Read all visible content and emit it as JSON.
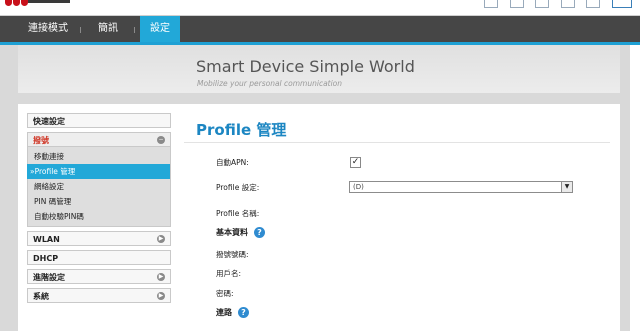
{
  "nav": {
    "tabs": [
      {
        "label": "連接模式"
      },
      {
        "label": "簡訊"
      },
      {
        "label": "設定"
      }
    ],
    "active_tab": "設定",
    "accent_color": "#22a8d8"
  },
  "status_icons": [
    "sms-icon",
    "signal-strength-icon",
    "sim-icon",
    "globe-icon",
    "connection-icon",
    "battery-icon"
  ],
  "banner": {
    "title": "Smart Device   Simple World",
    "subtitle": "Mobilize your personal communication"
  },
  "sidebar": {
    "quick_setup": "快速設定",
    "dialup": {
      "label": "撥號",
      "items": [
        {
          "label": "移動連接"
        },
        {
          "label": "»Profile 管理"
        },
        {
          "label": "網絡設定"
        },
        {
          "label": "PIN 碼管理"
        },
        {
          "label": "自動校驗PIN碼"
        }
      ],
      "selected": "»Profile 管理"
    },
    "wlan": "WLAN",
    "dhcp": "DHCP",
    "advanced": "進階設定",
    "system": "系統",
    "collapse_icon": "minus-circle-icon",
    "expand_icon": "play-circle-icon"
  },
  "content": {
    "title": "Profile 管理",
    "auto_apn_label": "自動APN:",
    "auto_apn_checked": true,
    "profile_setting_label": "Profile 設定:",
    "profile_setting_value": "(D)",
    "profile_name_label": "Profile 名稱:",
    "basic_section": "基本資料",
    "dial_number_label": "撥號號碼:",
    "username_label": "用戶名:",
    "password_label": "密碼:",
    "apn_section": "連路",
    "help_label": "?"
  }
}
